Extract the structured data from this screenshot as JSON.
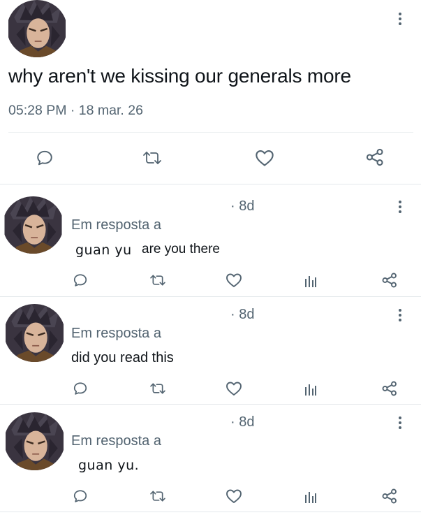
{
  "main_post": {
    "text": "why aren't we kissing our generals more",
    "timestamp": "05:28 PM · 18 mar. 26"
  },
  "replies": [
    {
      "time": "· 8d",
      "reply_to_label": "Em resposta a",
      "mention": "guan yu",
      "text": "are you there"
    },
    {
      "time": "· 8d",
      "reply_to_label": "Em resposta a",
      "mention": "",
      "text": "did you read this"
    },
    {
      "time": "· 8d",
      "reply_to_label": "Em resposta a",
      "mention": "guan yu.",
      "text": ""
    }
  ],
  "icons": {
    "reply": "comment-icon",
    "repost": "repost-icon",
    "like": "heart-icon",
    "views": "analytics-icon",
    "share": "share-icon",
    "more": "more-vertical-icon"
  },
  "colors": {
    "icon": "#536471",
    "text": "#0f1419",
    "muted": "#536471",
    "divider": "#e4e8eb"
  }
}
